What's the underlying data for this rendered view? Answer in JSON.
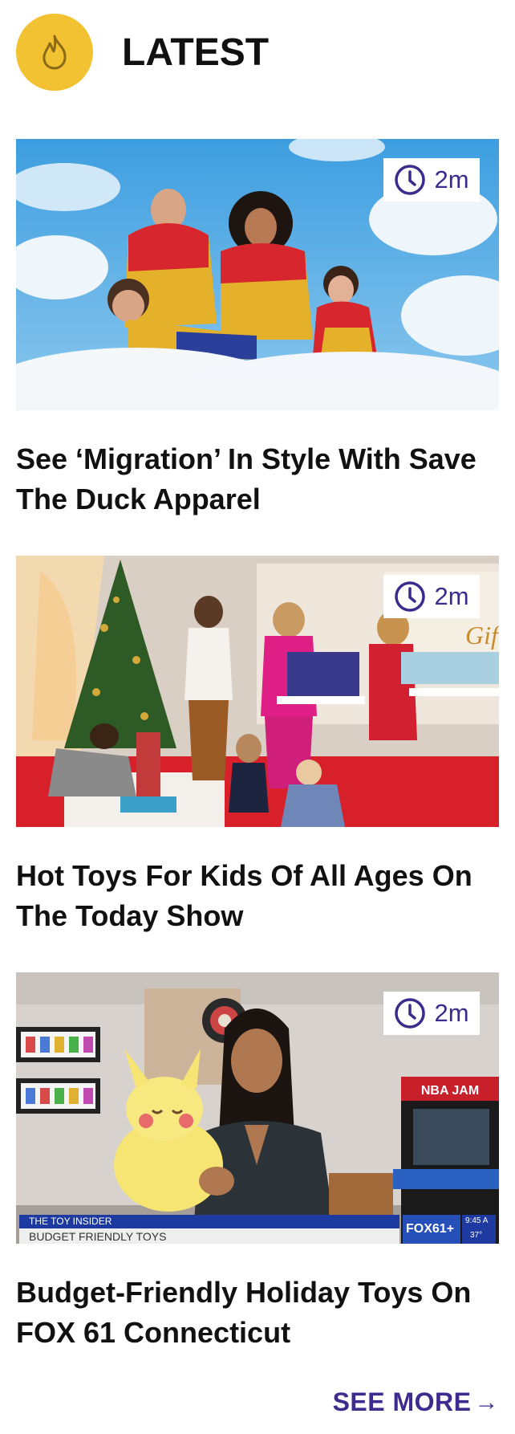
{
  "header": {
    "title": "LATEST",
    "icon": "flame-icon",
    "badge_color": "#f2c232"
  },
  "articles": [
    {
      "title": "See ‘Migration’ In Style With Save The Duck Apparel",
      "read_time": "2m",
      "image": "family-in-puffer-jackets"
    },
    {
      "title": "Hot Toys For Kids Of All Ages On The Today Show",
      "read_time": "2m",
      "image": "today-show-toy-segment"
    },
    {
      "title": "Budget-Friendly Holiday Toys On FOX 61 Connecticut",
      "read_time": "2m",
      "image": "fox61-toy-segment",
      "lower_third": {
        "top": "THE TOY INSIDER",
        "bottom": "BUDGET FRIENDLY TOYS",
        "logo": "FOX61+",
        "time": "9:45 A",
        "temp": "37°"
      }
    }
  ],
  "see_more": {
    "label": "SEE MORE",
    "arrow": "→"
  },
  "colors": {
    "accent": "#3d2c8d",
    "text": "#111111"
  }
}
